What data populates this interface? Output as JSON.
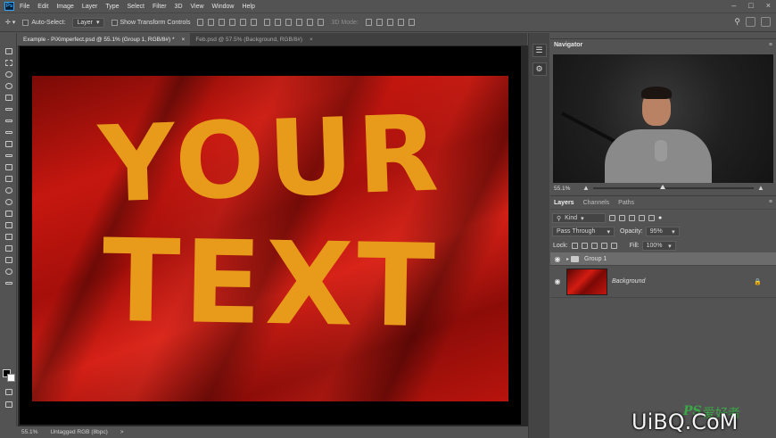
{
  "menubar": {
    "items": [
      "File",
      "Edit",
      "Image",
      "Layer",
      "Type",
      "Select",
      "Filter",
      "3D",
      "View",
      "Window",
      "Help"
    ]
  },
  "options": {
    "auto_select_label": "Auto-Select:",
    "auto_select_value": "Layer",
    "transform_label": "Show Transform Controls",
    "mode_3d": "3D Mode:"
  },
  "tabs": [
    {
      "label": "Example - PiXimperfect.psd @ 55.1% (Group 1, RGB/8#) *",
      "active": true
    },
    {
      "label": "Feb.psd @ 57.5% (Background, RGB/8#)",
      "active": false
    }
  ],
  "canvas": {
    "line1": "YOUR",
    "line2": "TEXT"
  },
  "status": {
    "zoom": "55.1%",
    "profile": "Untagged RGB (8bpc)",
    "arrow": ">"
  },
  "navigator": {
    "title": "Navigator",
    "zoom": "55.1%"
  },
  "layers_panel": {
    "tabs": [
      "Layers",
      "Channels",
      "Paths"
    ],
    "kind": "Kind",
    "blend_mode": "Pass Through",
    "opacity_label": "Opacity:",
    "opacity_value": "95%",
    "lock_label": "Lock:",
    "fill_label": "Fill:",
    "fill_value": "100%",
    "layers": [
      {
        "name": "Group 1",
        "type": "group",
        "selected": true
      },
      {
        "name": "Background",
        "type": "image",
        "selected": false
      }
    ]
  },
  "watermark": {
    "text": "UiBQ.CoM",
    "ps": "PS",
    "cn": "爱好者"
  },
  "colors": {
    "flag_red": "#c5170f",
    "text_gold": "#e89a1a",
    "ui_panel": "#535353",
    "watermark_green": "#3aa845"
  }
}
